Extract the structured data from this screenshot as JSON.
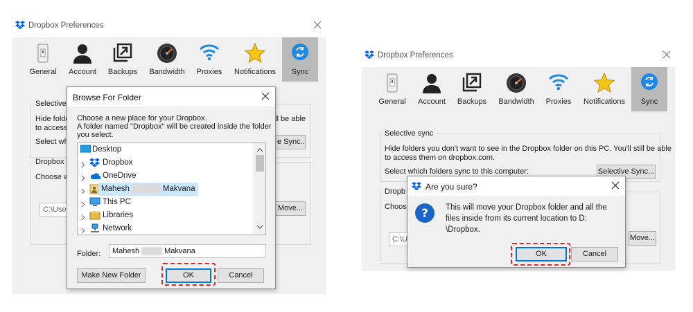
{
  "windows": {
    "left": {
      "title": "Dropbox Preferences",
      "tabs": [
        {
          "label": "General",
          "icon": "general-switch-icon"
        },
        {
          "label": "Account",
          "icon": "account-person-icon"
        },
        {
          "label": "Backups",
          "icon": "backups-icon"
        },
        {
          "label": "Bandwidth",
          "icon": "bandwidth-gauge-icon"
        },
        {
          "label": "Proxies",
          "icon": "proxies-wifi-icon"
        },
        {
          "label": "Notifications",
          "icon": "notifications-star-icon"
        },
        {
          "label": "Sync",
          "icon": "sync-icon",
          "active": true
        }
      ],
      "selective_sync_title": "Selective s",
      "hide_text_1": "Hide folde",
      "hide_text_1b": "ll be able",
      "hide_text_2": "to access t",
      "select_which": "Select whi",
      "selective_sync_button": "e Sync...",
      "dropbox_folder_title": "Dropbox fo",
      "choose_where": "Choose w",
      "path_value": "C:\\User",
      "move_button": "Move..."
    },
    "right": {
      "title": "Dropbox Preferences",
      "tabs": [
        {
          "label": "General",
          "icon": "general-switch-icon"
        },
        {
          "label": "Account",
          "icon": "account-person-icon"
        },
        {
          "label": "Backups",
          "icon": "backups-icon"
        },
        {
          "label": "Bandwidth",
          "icon": "bandwidth-gauge-icon"
        },
        {
          "label": "Proxies",
          "icon": "proxies-wifi-icon"
        },
        {
          "label": "Notifications",
          "icon": "notifications-star-icon"
        },
        {
          "label": "Sync",
          "icon": "sync-icon",
          "active": true
        }
      ],
      "selective_sync_title": "Selective sync",
      "hide_text_1": "Hide folders you don't want to see in the Dropbox folder on this PC. You'll still be able",
      "hide_text_2": "to access them on dropbox.com.",
      "select_which": "Select which folders sync to this computer:",
      "selective_sync_button": "Selective Sync...",
      "dropbox_folder_title": "Dropb",
      "choose_where": "Choose",
      "path_value": "C:\\U",
      "move_button": "Move..."
    }
  },
  "browse_dialog": {
    "title": "Browse For Folder",
    "description_1": "Choose a new place for your Dropbox.",
    "description_2": "A folder named \"Dropbox\" will be created inside the folder",
    "description_3": "you select.",
    "tree_items": [
      {
        "label": "Desktop",
        "icon": "desktop-icon",
        "chevron": false
      },
      {
        "label": "Dropbox",
        "icon": "dropbox-icon",
        "chevron": true
      },
      {
        "label": "OneDrive",
        "icon": "onedrive-cloud-icon",
        "chevron": true
      },
      {
        "label_first": "Mahesh",
        "label_last": "Makvana",
        "icon": "user-folder-icon",
        "chevron": true,
        "selected": true
      },
      {
        "label": "This PC",
        "icon": "this-pc-icon",
        "chevron": true
      },
      {
        "label": "Libraries",
        "icon": "libraries-icon",
        "chevron": true
      },
      {
        "label": "Network",
        "icon": "network-icon",
        "chevron": true
      }
    ],
    "folder_label": "Folder:",
    "folder_value_first": "Mahesh",
    "folder_value_last": "Makvana",
    "make_new_folder": "Make New Folder",
    "ok": "OK",
    "cancel": "Cancel"
  },
  "confirm_dialog": {
    "title": "Are you sure?",
    "message_1": "This will move your Dropbox folder and all the",
    "message_2": "files inside from its current location to D:",
    "message_3": "\\Dropbox.",
    "ok": "OK",
    "cancel": "Cancel"
  },
  "colors": {
    "dropbox_blue": "#0061fe",
    "sync_blue": "#1e88e5",
    "highlight_red": "#e0262b",
    "selected_bg": "#cce8ff"
  }
}
